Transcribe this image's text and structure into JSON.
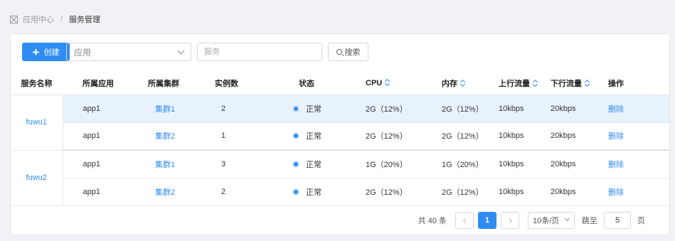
{
  "breadcrumb": {
    "parent": "应用中心",
    "separator": "/",
    "current": "服务管理"
  },
  "toolbar": {
    "create_label": "创建",
    "app_select_value": "应用",
    "service_placeholder": "服务",
    "search_label": "搜索"
  },
  "table": {
    "headers": {
      "name": "服务名称",
      "app": "所属应用",
      "cluster": "所属集群",
      "instances": "实例数",
      "status": "状态",
      "cpu": "CPU",
      "memory": "内存",
      "up": "上行流量",
      "down": "下行流量",
      "ops": "操作"
    },
    "groups": [
      {
        "name": "fuwu1",
        "rows": [
          {
            "app": "app1",
            "cluster": "集群1",
            "instances": "2",
            "status": "正常",
            "cpu": "2G（12%）",
            "memory": "2G（12%）",
            "up": "10kbps",
            "down": "20kbps",
            "op": "删除"
          },
          {
            "app": "app1",
            "cluster": "集群2",
            "instances": "1",
            "status": "正常",
            "cpu": "2G（12%）",
            "memory": "2G（12%）",
            "up": "10kbps",
            "down": "20kbps",
            "op": "删除"
          }
        ]
      },
      {
        "name": "fuwu2",
        "rows": [
          {
            "app": "app1",
            "cluster": "集群1",
            "instances": "3",
            "status": "正常",
            "cpu": "1G（20%）",
            "memory": "1G（20%）",
            "up": "10kbps",
            "down": "20kbps",
            "op": "删除"
          },
          {
            "app": "app1",
            "cluster": "集群2",
            "instances": "2",
            "status": "正常",
            "cpu": "2G（12%）",
            "memory": "2G（12%）",
            "up": "10kbps",
            "down": "20kbps",
            "op": "删除"
          }
        ]
      }
    ]
  },
  "pagination": {
    "total": "共 40 条",
    "current_page": "1",
    "page_size": "10条/页",
    "jump_label": "跳至",
    "jump_value": "5",
    "page_unit": "页"
  },
  "colors": {
    "accent": "#2f8cf0",
    "highlight_row": "#e8f2fd",
    "background": "#f0f2f5"
  },
  "icons": {
    "breadcrumb": "box-icon",
    "create": "plus-icon",
    "search": "search-icon",
    "sort": "sort-icon"
  }
}
